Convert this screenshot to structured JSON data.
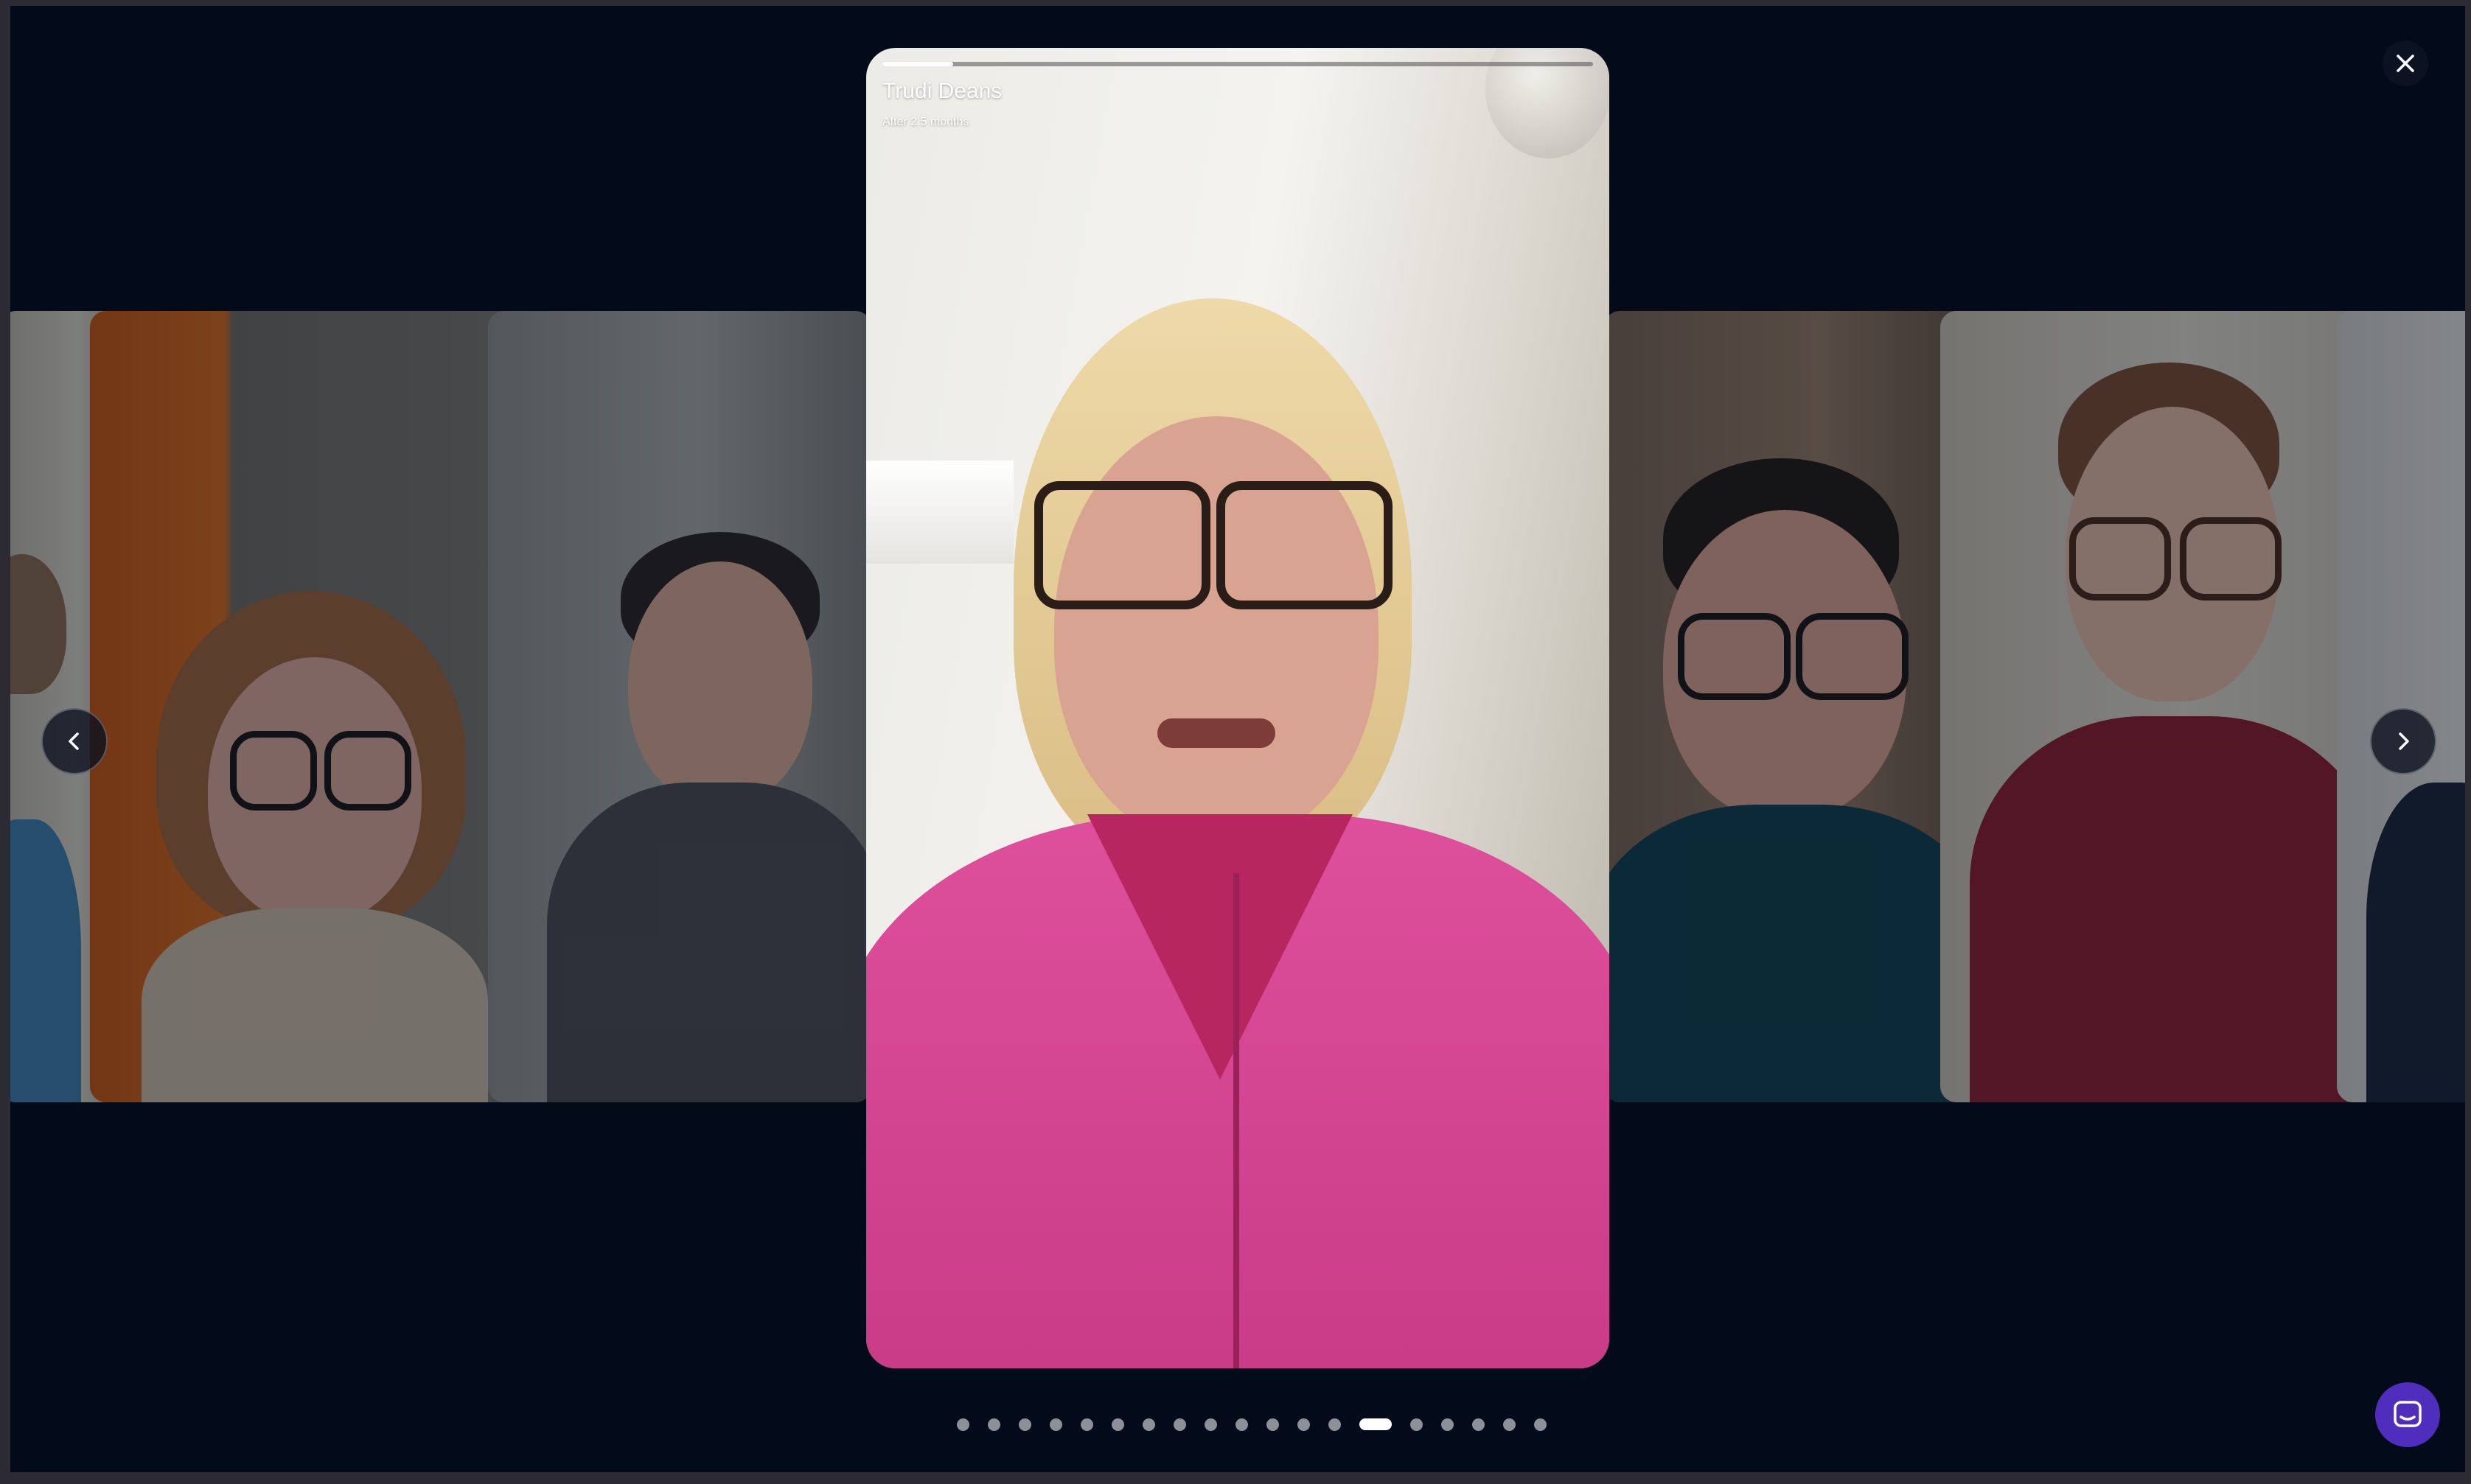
{
  "story": {
    "name": "Trudi Deans",
    "subtitle": "After 2.5 months",
    "progress": 0.1
  },
  "controls": {
    "close_icon": "close-icon",
    "prev_icon": "chevron-left-icon",
    "next_icon": "chevron-right-icon",
    "chat_icon": "chat-bubble-icon"
  },
  "pagination": {
    "total": 19,
    "active_index": 13
  },
  "colors": {
    "backdrop": "#030b1a",
    "chat_button": "#4f2dbd",
    "active_dot": "#ffffff",
    "inactive_dot": "#8b9099"
  }
}
